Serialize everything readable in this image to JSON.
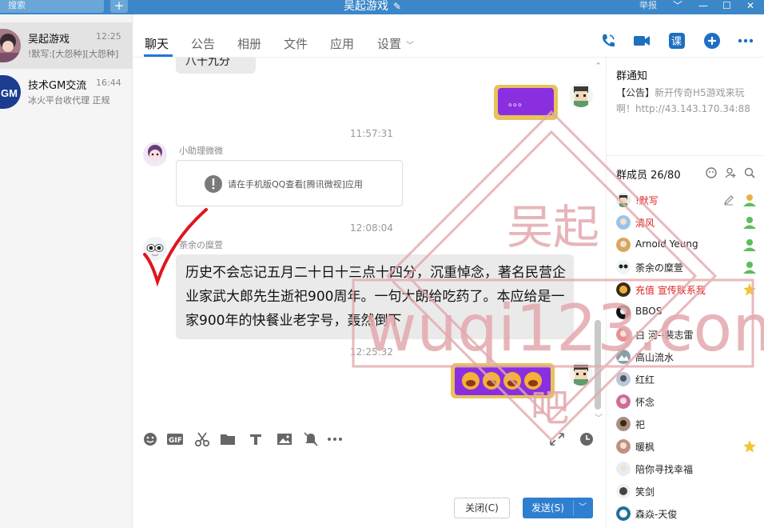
{
  "topbar": {
    "search_placeholder": "搜索",
    "title": "吴起游戏",
    "report": "举报"
  },
  "conversations": [
    {
      "name": "吴起游戏",
      "time": "12:25",
      "preview": "!默写:[大怨种][大怨种]"
    },
    {
      "name": "技术GM交流",
      "time": "16:44",
      "preview": "冰火平台收代理 正规"
    }
  ],
  "tabs": [
    "聊天",
    "公告",
    "相册",
    "文件",
    "应用",
    "设置"
  ],
  "chat": {
    "top_bubble_text": "八十九分",
    "sticker_dots": "。。。",
    "messages": [
      {
        "time": "11:57:31",
        "sender": "小助理微微",
        "card_text": "请在手机版QQ查看[腾讯微视]应用"
      },
      {
        "time": "12:08:04",
        "sender": "荼余の糜萱",
        "text": "历史不会忘记五月二十日十三点十四分，沉重悼念，著名民营企业家武大郎先生逝祀900周年。一句大朗给吃药了。本应给是一家900年的快餐业老字号，轰然倒下"
      },
      {
        "time": "12:25:32"
      }
    ]
  },
  "buttons": {
    "close": "关闭(C)",
    "send": "发送(S)"
  },
  "notice": {
    "title": "群通知",
    "prefix": "【公告】",
    "body": "新开传奇H5游戏来玩啊！http://43.143.170.34:88"
  },
  "members": {
    "title": "群成员 26/80",
    "list": [
      {
        "name": "!默写",
        "color": "#e02020"
      },
      {
        "name": "清风",
        "color": "#e02020"
      },
      {
        "name": "Arnold Yeung",
        "color": "#222222"
      },
      {
        "name": "荼余の糜萱",
        "color": "#222222"
      },
      {
        "name": "充值 宣传联系我",
        "color": "#e02020"
      },
      {
        "name": "BBOS",
        "color": "#222222"
      },
      {
        "name": "白 河--裴志雷",
        "color": "#222222"
      },
      {
        "name": "高山流水",
        "color": "#222222"
      },
      {
        "name": "红红",
        "color": "#222222"
      },
      {
        "name": "怀念",
        "color": "#222222"
      },
      {
        "name": "祀",
        "color": "#222222"
      },
      {
        "name": "暖枫",
        "color": "#222222"
      },
      {
        "name": "陪你寻找幸福",
        "color": "#222222"
      },
      {
        "name": "笑剑",
        "color": "#222222"
      },
      {
        "name": "森焱-天俊",
        "color": "#222222"
      }
    ]
  },
  "watermark": {
    "chars_top": "吴起",
    "url": "wuqi123.com",
    "char_bottom": "吧"
  },
  "colors": {
    "accent": "#2f7fd1",
    "titlebar": "#3b87c8",
    "admin_red": "#e02020"
  }
}
